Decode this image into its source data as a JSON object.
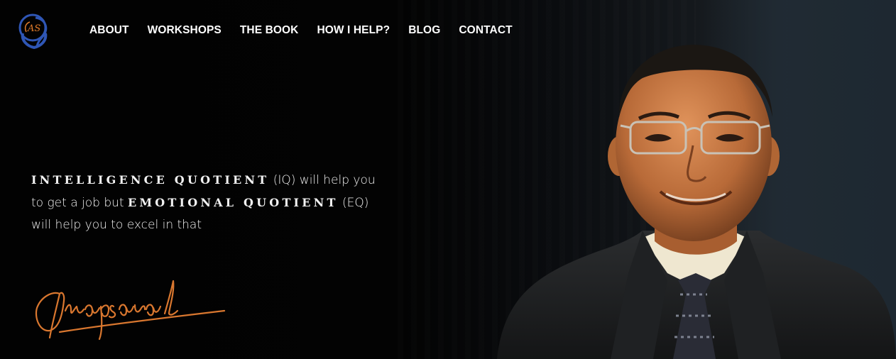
{
  "logo": {
    "initials": "AS",
    "icon": "head-in-hands-logo",
    "color": "#2f56b5",
    "accent": "#e07b2a"
  },
  "nav": {
    "items": [
      "ABOUT",
      "WORKSHOPS",
      "THE BOOK",
      "HOW I HELP?",
      "BLOG",
      "CONTACT"
    ]
  },
  "hero": {
    "quote": {
      "iq_term": "INTELLIGENCE QUOTIENT",
      "part1": " (IQ) will help you to get a job but ",
      "eq_term": "EMOTIONAL QUOTIENT",
      "part2": " (EQ) will help you to excel in that"
    },
    "signature": {
      "icon": "handwritten-signature",
      "color": "#d9772f"
    },
    "portrait": {
      "icon": "person-portrait"
    }
  }
}
